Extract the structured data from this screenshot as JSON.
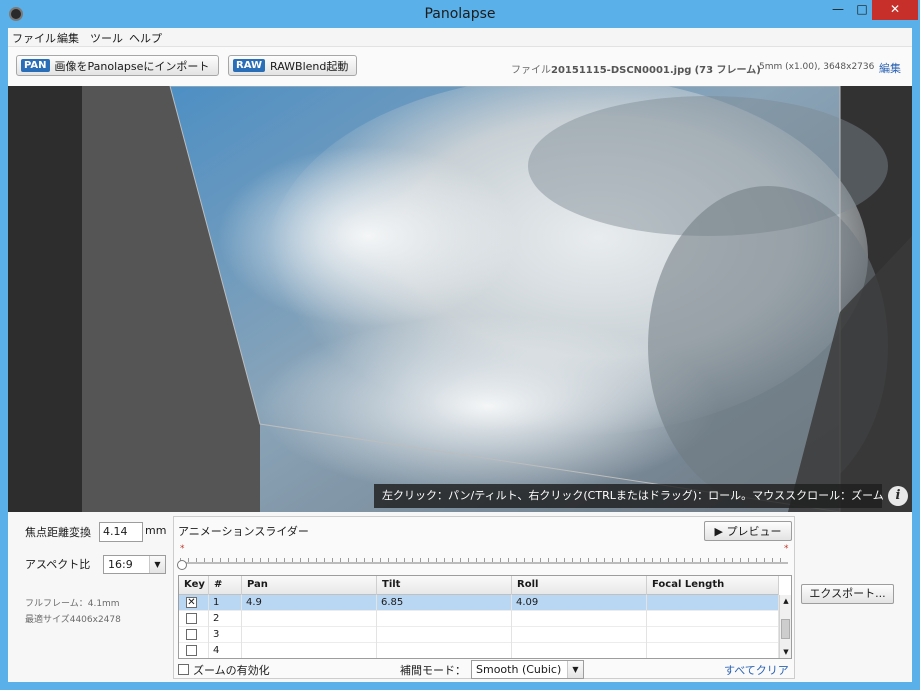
{
  "window": {
    "title": "Panolapse"
  },
  "menu": [
    "ファイル",
    "編集",
    "ツール",
    "ヘルプ"
  ],
  "toolbar": {
    "import_badge": "PAN",
    "import_label": "画像をPanolapseにインポート",
    "raw_badge": "RAW",
    "raw_label": "RAWBlend起動",
    "file_prefix": "ファイル",
    "file_name": "20151115-DSCN0001.jpg",
    "file_frames": "(73 フレーム)",
    "lens_info": "5mm (x1.00), 3648x2736",
    "edit_label": "編集"
  },
  "viewport": {
    "hint": "左クリック：パン/ティルト、右クリック(CTRLまたはドラッグ)：ロール。マウススクロール：ズーム",
    "info_icon": "i"
  },
  "settings": {
    "focal_label": "焦点距離変換",
    "focal_value": "4.14",
    "focal_unit": "mm",
    "aspect_label": "アスペクト比",
    "aspect_value": "16:9",
    "fullframe_text": "フルフレーム：4.1mm",
    "optimal_text": "最適サイズ4406x2478"
  },
  "animation": {
    "title": "アニメーションスライダー",
    "preview_label": "▶ プレビュー",
    "slider_position": 0,
    "marker": "*",
    "columns": [
      "Key",
      "#",
      "Pan",
      "Tilt",
      "Roll",
      "Focal Length"
    ],
    "rows": [
      {
        "key": true,
        "num": "1",
        "pan": "4.9",
        "tilt": "6.85",
        "roll": "4.09",
        "focal": ""
      },
      {
        "key": false,
        "num": "2",
        "pan": "",
        "tilt": "",
        "roll": "",
        "focal": ""
      },
      {
        "key": false,
        "num": "3",
        "pan": "",
        "tilt": "",
        "roll": "",
        "focal": ""
      },
      {
        "key": false,
        "num": "4",
        "pan": "",
        "tilt": "",
        "roll": "",
        "focal": ""
      }
    ],
    "zoom_enable_label": "ズームの有効化",
    "interp_label": "補間モード：",
    "interp_value": "Smooth (Cubic)",
    "clear_all_label": "すべてクリア"
  },
  "export_label": "エクスポート..."
}
